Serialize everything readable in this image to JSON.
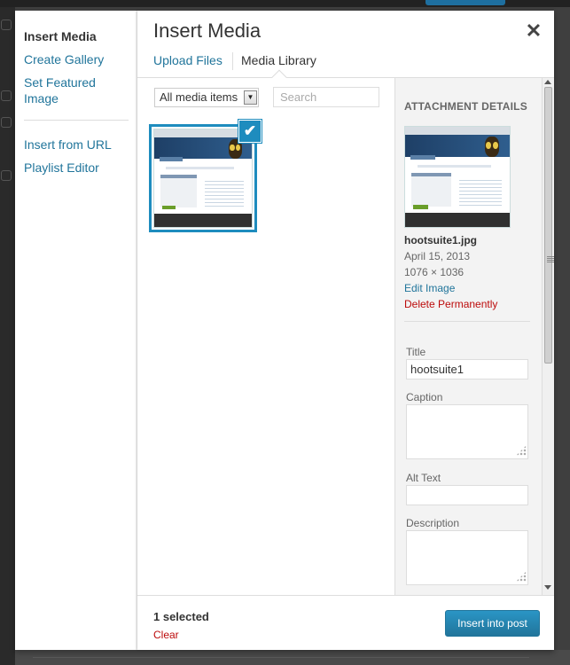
{
  "menu": {
    "title": "Insert Media",
    "items": [
      "Create Gallery",
      "Set Featured Image",
      "Insert from URL",
      "Playlist Editor"
    ]
  },
  "frame": {
    "title": "Insert Media",
    "close_icon": "close-icon",
    "tabs": [
      {
        "label": "Upload Files",
        "active": false
      },
      {
        "label": "Media Library",
        "active": true
      }
    ]
  },
  "toolbar": {
    "filter_value": "All media items",
    "search_placeholder": "Search"
  },
  "library": {
    "selected_count": 1
  },
  "details": {
    "heading": "ATTACHMENT DETAILS",
    "filename": "hootsuite1.jpg",
    "date": "April 15, 2013",
    "dimensions": "1076 × 1036",
    "edit_label": "Edit Image",
    "delete_label": "Delete Permanently",
    "fields": {
      "title_label": "Title",
      "title_value": "hootsuite1",
      "caption_label": "Caption",
      "caption_value": "",
      "alt_label": "Alt Text",
      "alt_value": "",
      "description_label": "Description",
      "description_value": ""
    }
  },
  "footer": {
    "selection_text": "1 selected",
    "clear_label": "Clear",
    "insert_label": "Insert into post"
  },
  "colors": {
    "accent": "#21759b",
    "selected_border": "#1e8cbe",
    "danger": "#bc0b0b"
  }
}
